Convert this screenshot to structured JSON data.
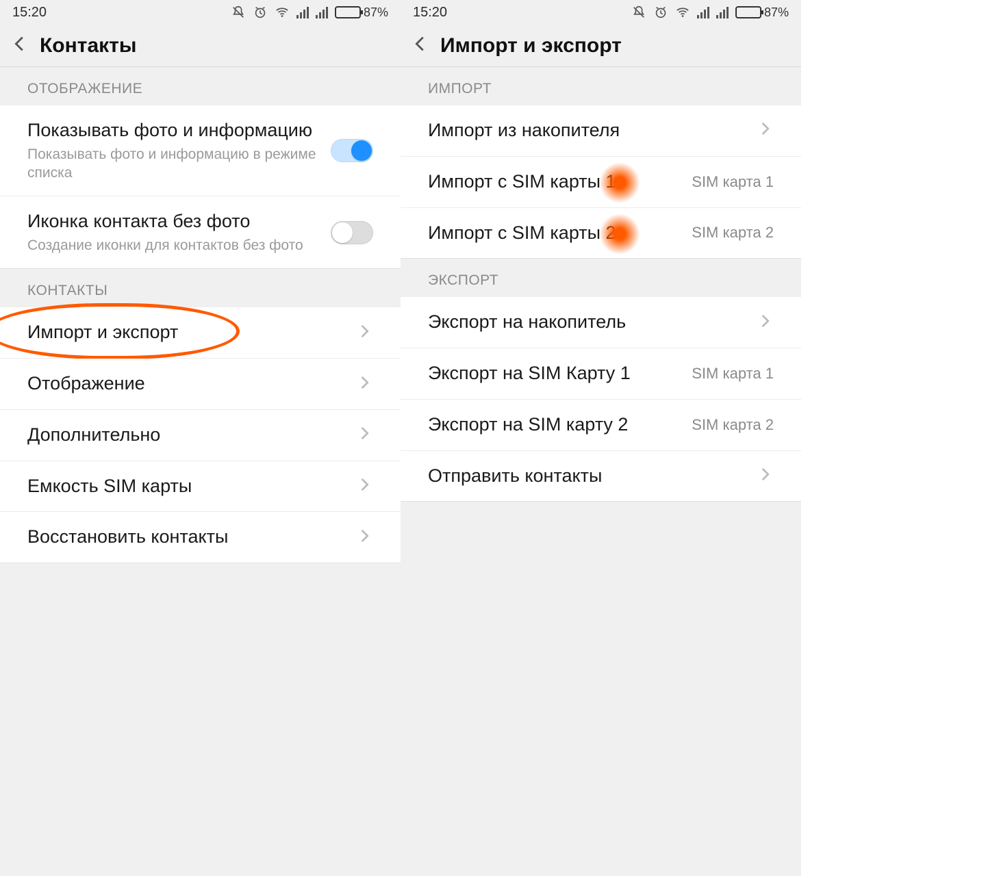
{
  "status": {
    "time": "15:20",
    "battery_pct": "87%"
  },
  "left": {
    "title": "Контакты",
    "section_display": "ОТОБРАЖЕНИЕ",
    "show_photo": {
      "title": "Показывать фото и информацию",
      "sub": "Показывать фото и информацию в режиме списка"
    },
    "icon_nophoto": {
      "title": "Иконка контакта без фото",
      "sub": "Создание иконки для контактов без фото"
    },
    "section_contacts": "КОНТАКТЫ",
    "rows": {
      "import_export": "Импорт и экспорт",
      "display": "Отображение",
      "advanced": "Дополнительно",
      "sim_capacity": "Емкость SIM карты",
      "restore": "Восстановить контакты"
    }
  },
  "right": {
    "title": "Импорт и экспорт",
    "section_import": "ИМПОРТ",
    "import_storage": "Импорт из накопителя",
    "import_sim1": {
      "label": "Импорт с SIM карты 1",
      "value": "SIM карта 1"
    },
    "import_sim2": {
      "label": "Импорт с SIM карты 2",
      "value": "SIM карта 2"
    },
    "section_export": "ЭКСПОРТ",
    "export_storage": "Экспорт на накопитель",
    "export_sim1": {
      "label": "Экспорт на SIM Карту 1",
      "value": "SIM карта 1"
    },
    "export_sim2": {
      "label": "Экспорт на SIM карту 2",
      "value": "SIM карта 2"
    },
    "send_contacts": "Отправить контакты"
  }
}
